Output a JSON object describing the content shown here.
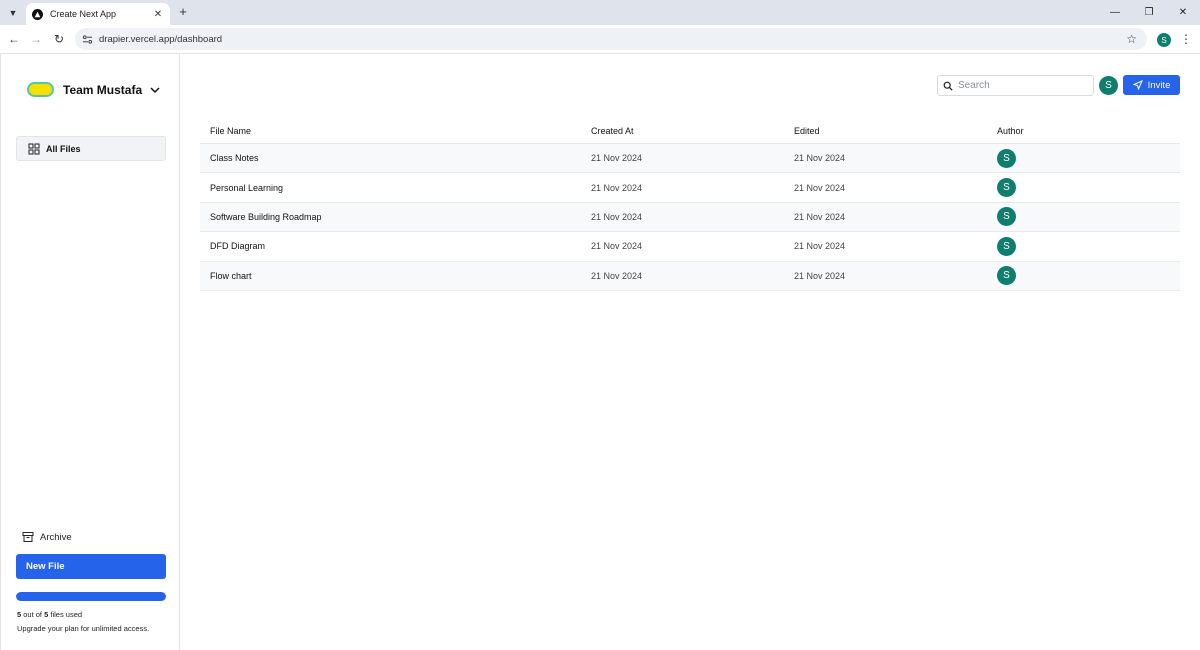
{
  "browser": {
    "tab_title": "Create Next App",
    "url": "drapier.vercel.app/dashboard",
    "profile_initial": "S"
  },
  "sidebar": {
    "team_name": "Team Mustafa",
    "all_files_label": "All Files",
    "archive_label": "Archive",
    "new_file_label": "New File",
    "usage": {
      "used": "5",
      "total": "5",
      "text_mid": " out of ",
      "text_end": " files used",
      "fraction": 1.0
    },
    "upgrade_text": "Upgrade your plan for unlimited access."
  },
  "header": {
    "search_placeholder": "Search",
    "user_initial": "S",
    "invite_label": "Invite"
  },
  "table": {
    "columns": [
      "File Name",
      "Created At",
      "Edited",
      "Author"
    ],
    "rows": [
      {
        "name": "Class Notes",
        "created": "21 Nov 2024",
        "edited": "21 Nov 2024",
        "author": "S"
      },
      {
        "name": "Personal Learning",
        "created": "21 Nov 2024",
        "edited": "21 Nov 2024",
        "author": "S"
      },
      {
        "name": "Software Building Roadmap",
        "created": "21 Nov 2024",
        "edited": "21 Nov 2024",
        "author": "S"
      },
      {
        "name": "DFD Diagram",
        "created": "21 Nov 2024",
        "edited": "21 Nov 2024",
        "author": "S"
      },
      {
        "name": "Flow chart",
        "created": "21 Nov 2024",
        "edited": "21 Nov 2024",
        "author": "S"
      }
    ]
  },
  "colors": {
    "primary": "#2563eb",
    "avatar": "#0e7f6e",
    "logo_fill": "#f5e000",
    "logo_border": "#53c7a4"
  }
}
